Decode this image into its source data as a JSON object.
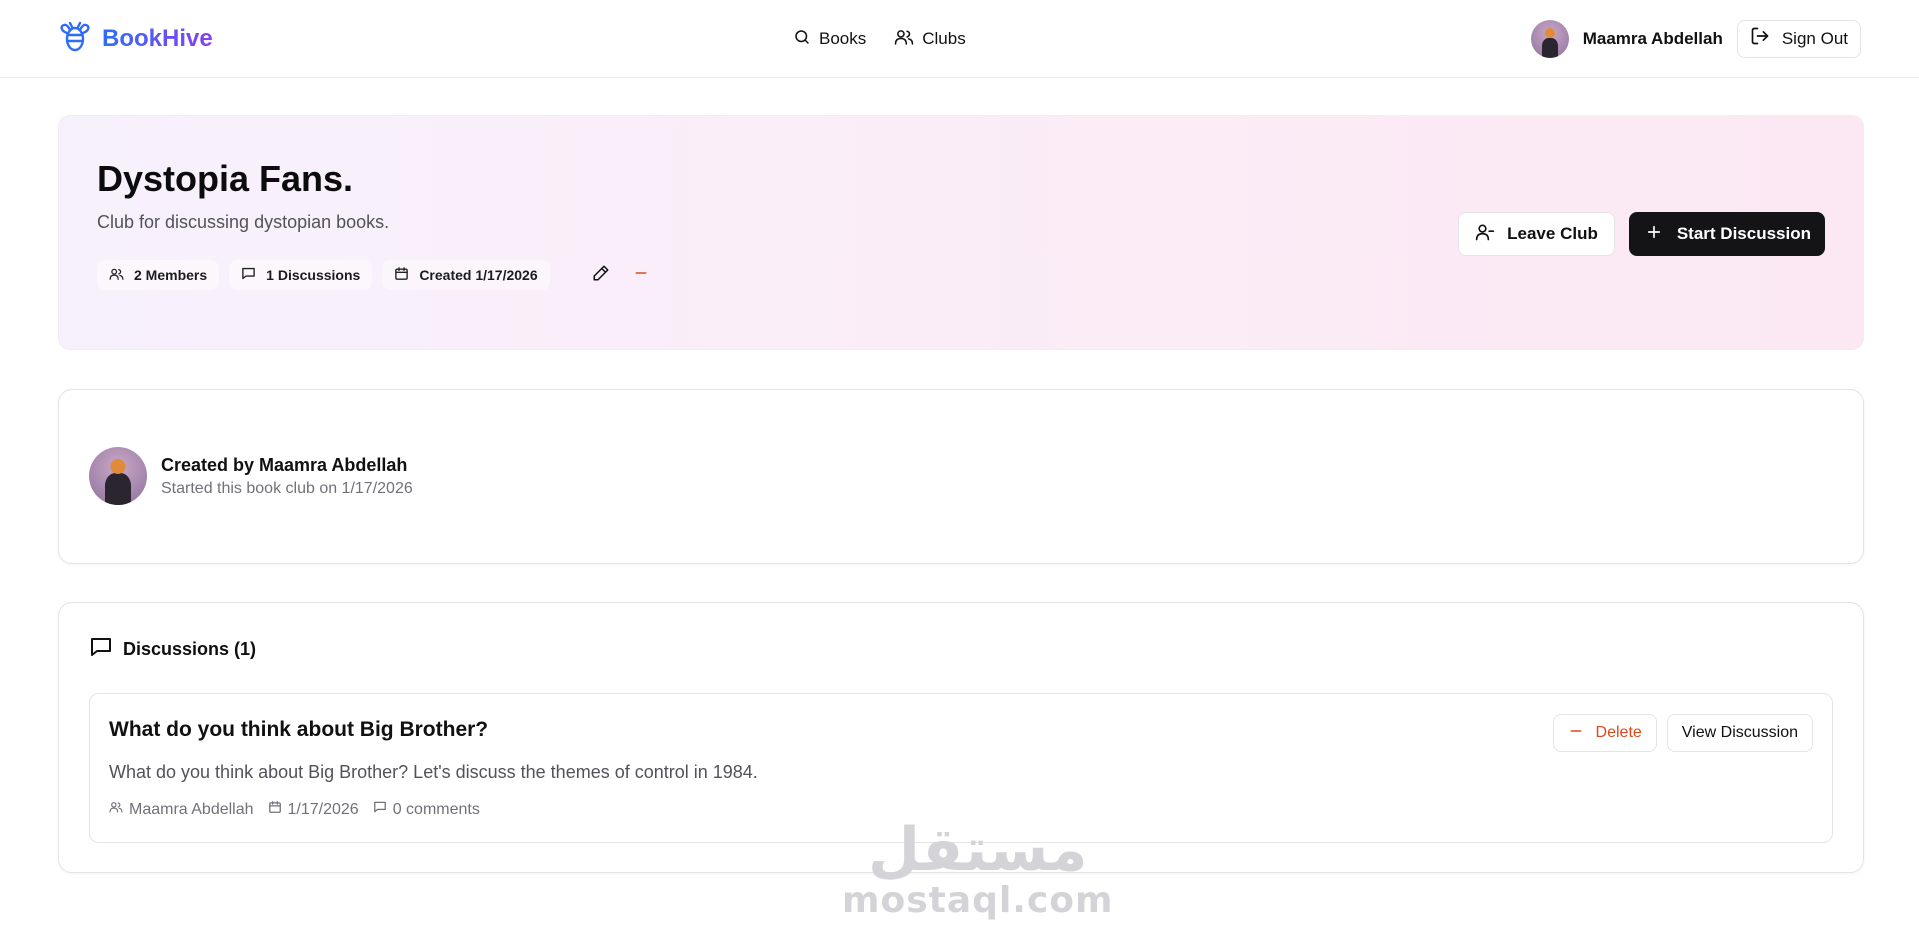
{
  "header": {
    "brand": "BookHive",
    "nav": [
      {
        "label": "Books",
        "icon": "search-icon"
      },
      {
        "label": "Clubs",
        "icon": "users-icon"
      }
    ],
    "user_name": "Maamra Abdellah",
    "sign_out_label": "Sign Out"
  },
  "club": {
    "title": "Dystopia Fans.",
    "description": "Club for discussing dystopian books.",
    "members": "2 Members",
    "discussions_count": "1 Discussions",
    "created": "Created 1/17/2026",
    "leave_label": "Leave Club",
    "start_label": "Start Discussion"
  },
  "creator": {
    "title": "Created by Maamra Abdellah",
    "subtitle": "Started this book club on 1/17/2026"
  },
  "discussions": {
    "heading": "Discussions (1)",
    "items": [
      {
        "title": "What do you think about Big Brother?",
        "body": "What do you think about Big Brother? Let's discuss the themes of control in 1984.",
        "author": "Maamra Abdellah",
        "date": "1/17/2026",
        "comments": "0 comments",
        "delete_label": "Delete",
        "view_label": "View Discussion"
      }
    ]
  },
  "watermark": {
    "arabic": "مستقل",
    "latin": "mostaql.com"
  },
  "colors": {
    "brand_start": "#2f6cf6",
    "brand_end": "#8b3ff2",
    "danger": "#dc4a1b",
    "primary_button": "#141416"
  }
}
